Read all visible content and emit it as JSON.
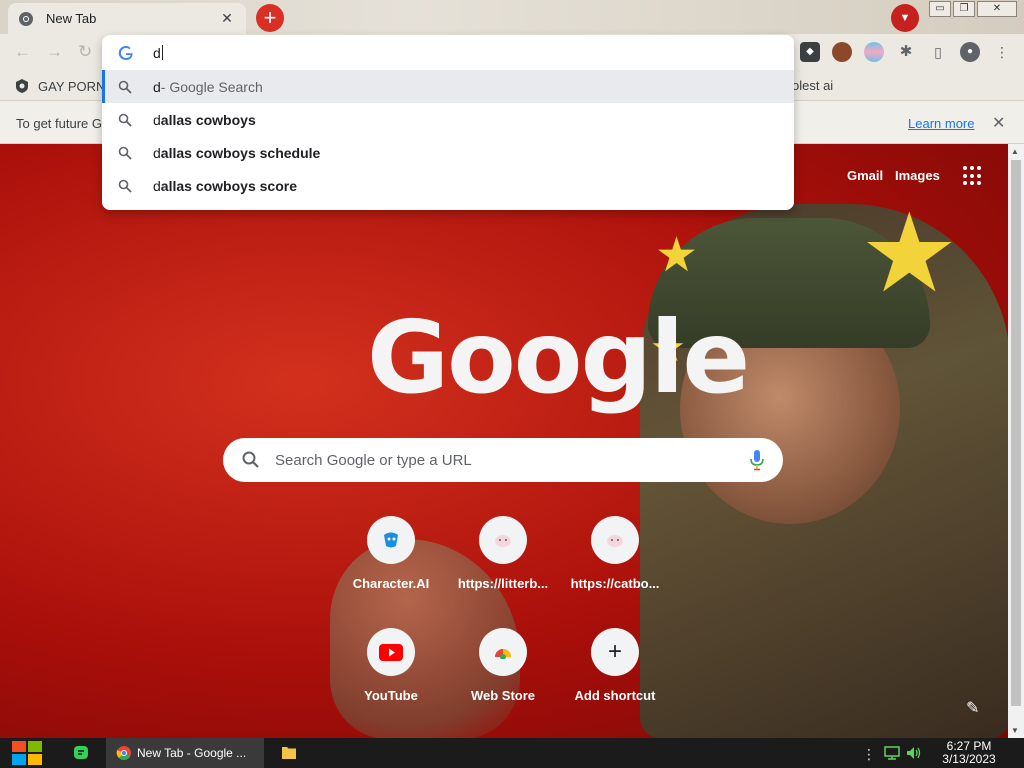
{
  "browser": {
    "tab": {
      "title": "New Tab",
      "close": "✕"
    },
    "new_tab_symbol": "+",
    "tab_search_symbol": "▼",
    "window_controls": [
      "▭",
      "❐",
      "✕"
    ]
  },
  "omnibox": {
    "typed": "d",
    "suggestions": [
      {
        "prefix": "d",
        "rest": "",
        "suffix": " - Google Search",
        "selected": true
      },
      {
        "prefix": "d",
        "rest": "allas cowboys",
        "suffix": "",
        "selected": false
      },
      {
        "prefix": "d",
        "rest": "allas cowboys schedule",
        "suffix": "",
        "selected": false
      },
      {
        "prefix": "d",
        "rest": "allas cowboys score",
        "suffix": "",
        "selected": false
      }
    ]
  },
  "bookmarks": [
    {
      "label": "GAY PORN",
      "icon": "bookmark-shield-icon"
    },
    {
      "label": "olest ai",
      "icon": ""
    }
  ],
  "infobar": {
    "message": "To get future G",
    "learn_more": "Learn more",
    "close": "✕"
  },
  "ntp": {
    "gmail": "Gmail",
    "images": "Images",
    "logo": "Google",
    "search_placeholder": "Search Google or type a URL",
    "shortcuts": [
      {
        "label": "Character.AI",
        "icon": "character-ai-icon"
      },
      {
        "label": "https://litterb...",
        "icon": "cat-face-icon"
      },
      {
        "label": "https://catbo...",
        "icon": "cat-face-icon"
      },
      {
        "label": "YouTube",
        "icon": "youtube-icon"
      },
      {
        "label": "Web Store",
        "icon": "web-store-icon"
      },
      {
        "label": "Add shortcut",
        "icon": "plus-icon"
      }
    ],
    "add_symbol": "+",
    "edit_symbol": "✎"
  },
  "taskbar": {
    "active_window": "New Tab - Google ...",
    "time": "6:27 PM",
    "date": "3/13/2023"
  },
  "colors": {
    "accent": "#1a73e8",
    "new_tab_button": "#d93025",
    "youtube_red": "#ff0000",
    "background_red": "#b4120c",
    "star_yellow": "#f3d33a"
  }
}
